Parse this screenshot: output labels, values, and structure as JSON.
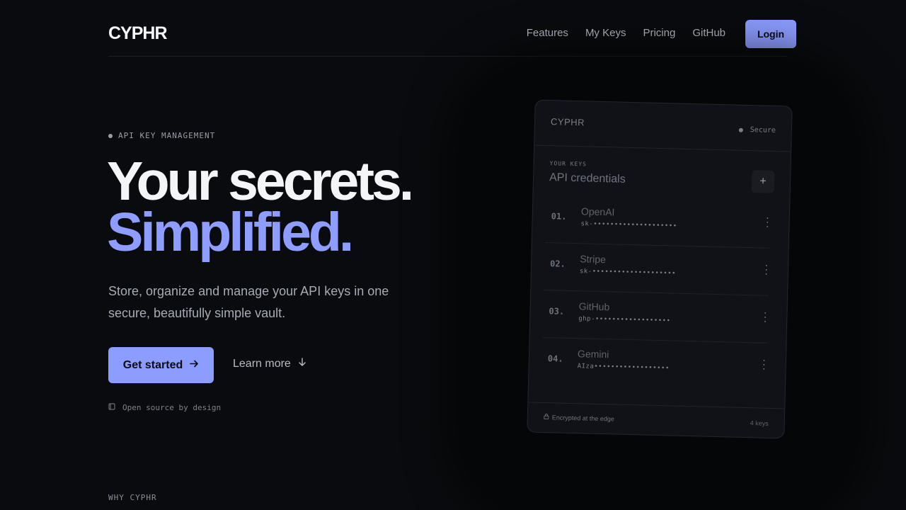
{
  "nav": {
    "logo": "CYPHR",
    "links": [
      "Features",
      "My Keys",
      "Pricing",
      "GitHub"
    ],
    "login": "Login"
  },
  "hero": {
    "eyebrow": "API KEY MANAGEMENT",
    "headline_line1": "Your secrets.",
    "headline_line2": "Simplified.",
    "subtitle": "Store, organize and manage your API keys in one secure, beautifully simple vault.",
    "cta_primary": "Get started",
    "cta_primary_icon": "arrow-right-icon",
    "cta_secondary": "Learn more",
    "cta_secondary_icon": "arrow-down-icon",
    "oss_note": "Open source by design",
    "section_label": "WHY CYPHR"
  },
  "card": {
    "brand": "CYPHR",
    "status": "Secure",
    "section_small": "YOUR KEYS",
    "section_title": "API credentials",
    "add_icon": "plus-icon",
    "keys": [
      {
        "num": "01.",
        "name": "OpenAI",
        "value": "sk-••••••••••••••••••••"
      },
      {
        "num": "02.",
        "name": "Stripe",
        "value": "sk-••••••••••••••••••••"
      },
      {
        "num": "03.",
        "name": "GitHub",
        "value": "ghp-••••••••••••••••••"
      },
      {
        "num": "04.",
        "name": "Gemini",
        "value": "AIza••••••••••••••••••"
      }
    ],
    "footer_left": "Encrypted at the edge",
    "footer_right": "4 keys"
  },
  "colors": {
    "background": "#0a0b0e",
    "accent": "#8c9cff",
    "text": "#f2f3f5"
  }
}
